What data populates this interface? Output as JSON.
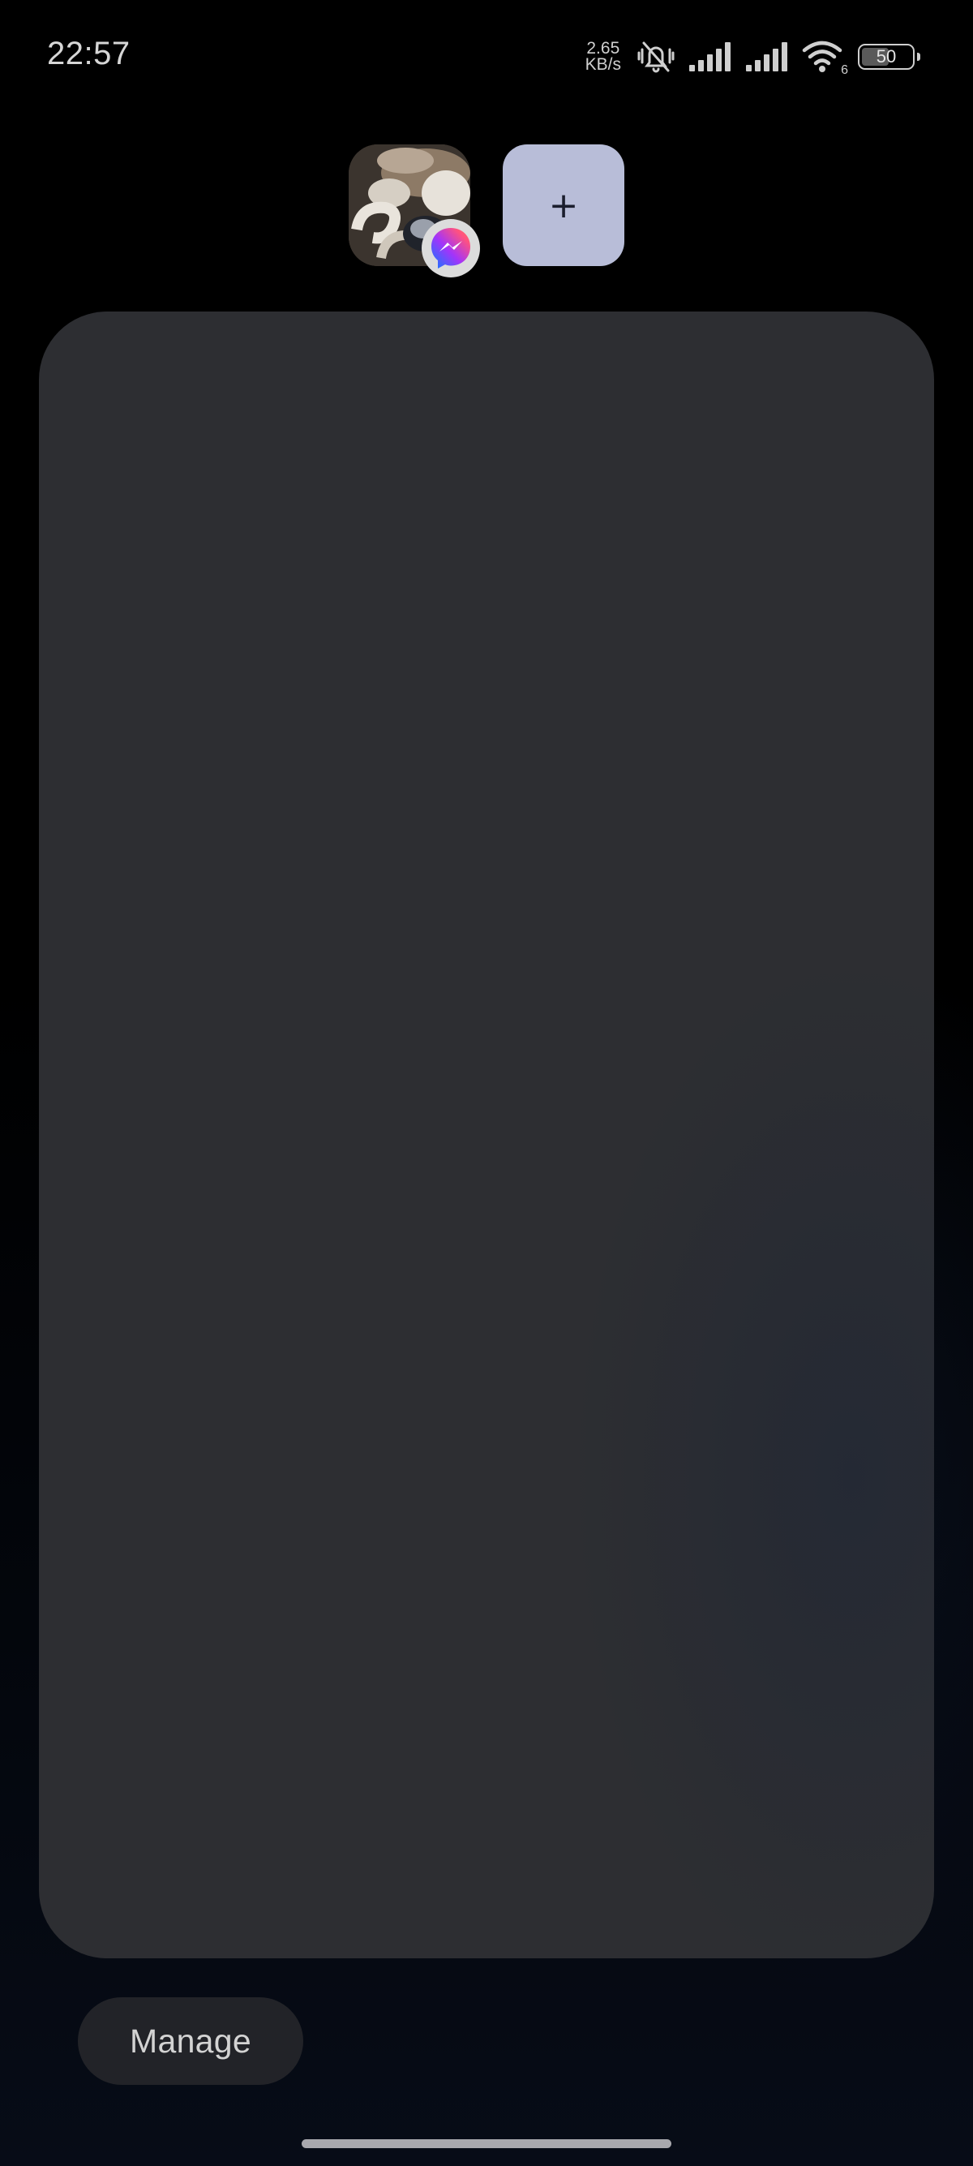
{
  "status_bar": {
    "time": "22:57",
    "net_speed_value": "2.65",
    "net_speed_unit": "KB/s",
    "icons": [
      "vibrate-silent-icon",
      "signal-strength-icon",
      "signal-strength-icon",
      "wifi-icon"
    ],
    "wifi_label": "6",
    "battery_level": "50"
  },
  "bubbles": {
    "chat_head_app": "messenger",
    "add_label": "+"
  },
  "manage_button": {
    "label": "Manage"
  },
  "colors": {
    "card": "#2d2e32",
    "add_button": "#b8bdd8",
    "manage_button": "#222328",
    "messenger_gradient": [
      "#0a7cff",
      "#a334fa",
      "#ff5280",
      "#ff7061"
    ]
  }
}
